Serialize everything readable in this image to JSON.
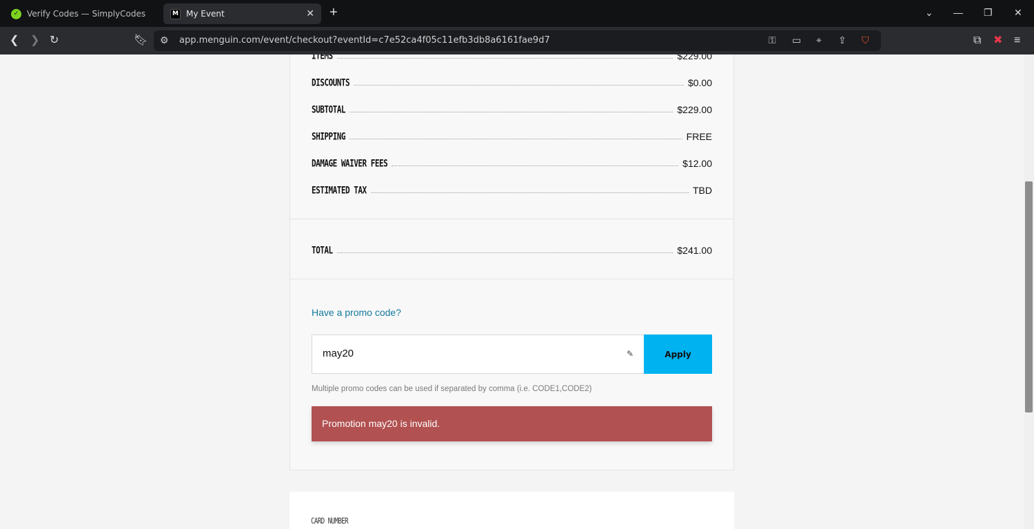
{
  "browser": {
    "tabs": [
      {
        "title": "Verify Codes — SimplyCodes",
        "active": false
      },
      {
        "title": "My Event",
        "active": true
      }
    ],
    "url": "app.menguin.com/event/checkout?eventId=c7e52ca4f05c11efb3db8a6161fae9d7"
  },
  "summary": {
    "rows": [
      {
        "label": "ITEMS",
        "value": "$229.00"
      },
      {
        "label": "DISCOUNTS",
        "value": "$0.00"
      },
      {
        "label": "SUBTOTAL",
        "value": "$229.00"
      },
      {
        "label": "SHIPPING",
        "value": "FREE"
      },
      {
        "label": "DAMAGE WAIVER FEES",
        "value": "$12.00"
      },
      {
        "label": "ESTIMATED TAX",
        "value": "TBD"
      }
    ],
    "total": {
      "label": "TOTAL",
      "value": "$241.00"
    }
  },
  "promo": {
    "link": "Have a promo code?",
    "input_value": "may20",
    "apply_label": "Apply",
    "helper": "Multiple promo codes can be used if separated by comma (i.e. CODE1,CODE2)",
    "error": "Promotion may20 is invalid."
  },
  "payment": {
    "card_number_label": "CARD NUMBER"
  },
  "colors": {
    "accent": "#00b3f0",
    "error": "#b25151",
    "link": "#137a9b"
  }
}
